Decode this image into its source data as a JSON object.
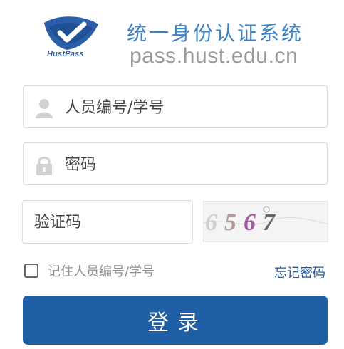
{
  "header": {
    "logo_caption": "HustPass",
    "system_title": "统一身份认证系统",
    "system_domain": "pass.hust.edu.cn"
  },
  "form": {
    "username": {
      "placeholder": "人员编号/学号",
      "value": "",
      "icon": "user-icon"
    },
    "password": {
      "placeholder": "密码",
      "value": "",
      "icon": "lock-icon"
    },
    "captcha": {
      "placeholder": "验证码",
      "value": "",
      "image_text": "6567"
    },
    "remember_label": "记住人员编号/学号",
    "remember_checked": false,
    "forgot_label": "忘记密码",
    "submit_label": "登录"
  },
  "colors": {
    "brand_blue": "#1e5fa5",
    "title_blue": "#3b83c6",
    "link_blue": "#1f5aa0",
    "domain_gray": "#9a9a9a"
  }
}
